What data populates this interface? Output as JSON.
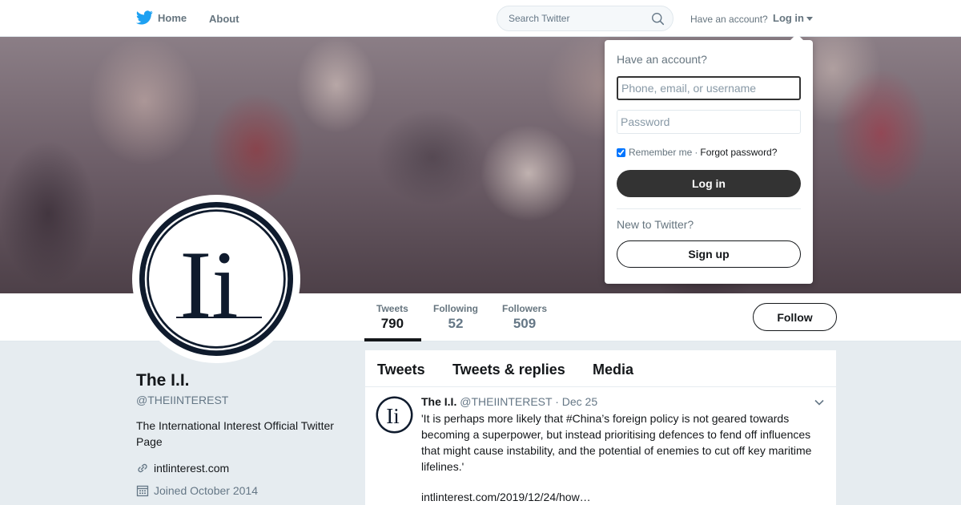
{
  "nav": {
    "home_label": "Home",
    "about_label": "About",
    "search_placeholder": "Search Twitter",
    "have_account": "Have an account?",
    "login_label": "Log in"
  },
  "profile": {
    "name": "The I.I.",
    "handle": "@THEIINTEREST",
    "bio": "The International Interest Official Twitter Page",
    "website": "intlinterest.com",
    "joined": "Joined October 2014",
    "logo_text": "Ii"
  },
  "stats": [
    {
      "label": "Tweets",
      "value": "790"
    },
    {
      "label": "Following",
      "value": "52"
    },
    {
      "label": "Followers",
      "value": "509"
    }
  ],
  "follow_label": "Follow",
  "timeline": {
    "tabs": [
      "Tweets",
      "Tweets & replies",
      "Media"
    ]
  },
  "tweet": {
    "name": "The I.I.",
    "handle": "@THEIINTEREST",
    "separator": "·",
    "date": "Dec 25",
    "text": "'It is perhaps more likely that #China’s foreign policy is not geared towards becoming a superpower, but instead prioritising defences to fend off influences that might cause instability, and the potential of enemies to cut off key maritime lifelines.'",
    "link": "intlinterest.com/2019/12/24/how…"
  },
  "login_dropdown": {
    "title": "Have an account?",
    "username_placeholder": "Phone, email, or username",
    "password_placeholder": "Password",
    "remember_label": "Remember me",
    "separator": "·",
    "forgot_label": "Forgot password?",
    "login_button": "Log in",
    "new_label": "New to Twitter?",
    "signup_button": "Sign up"
  },
  "colors": {
    "brand_blue": "#1da1f2",
    "dark": "#14171a",
    "muted": "#657786",
    "background": "#e6ecf0"
  },
  "icons": [
    "twitter-bird-icon",
    "search-icon",
    "caret-down-icon",
    "link-icon",
    "calendar-icon",
    "chevron-down-icon"
  ]
}
